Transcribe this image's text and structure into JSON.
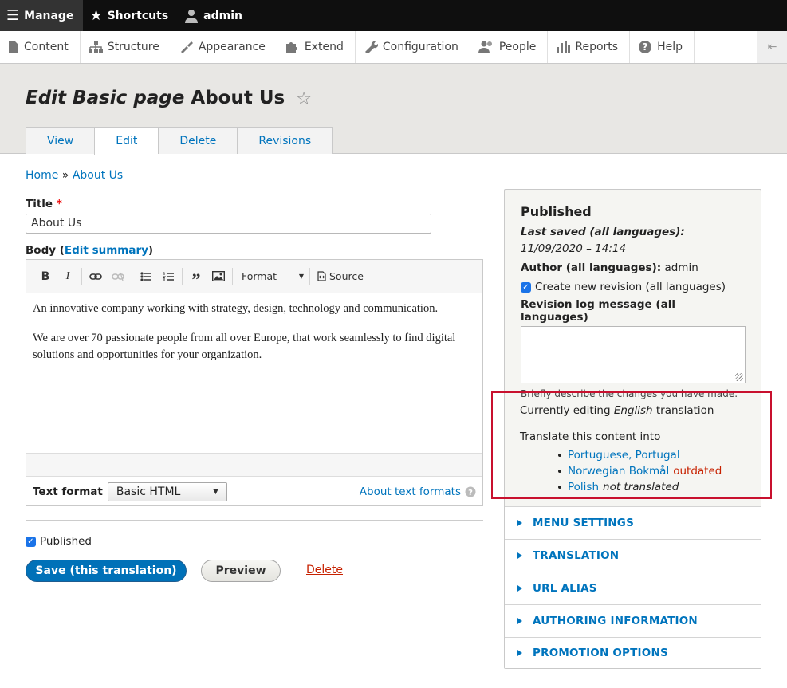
{
  "toolbar": {
    "manage": "Manage",
    "shortcuts": "Shortcuts",
    "user": "admin"
  },
  "admin_menu": [
    {
      "label": "Content",
      "icon": "file-icon"
    },
    {
      "label": "Structure",
      "icon": "sitemap-icon"
    },
    {
      "label": "Appearance",
      "icon": "paintbrush-icon"
    },
    {
      "label": "Extend",
      "icon": "puzzle-icon"
    },
    {
      "label": "Configuration",
      "icon": "wrench-icon"
    },
    {
      "label": "People",
      "icon": "people-icon"
    },
    {
      "label": "Reports",
      "icon": "bar-chart-icon"
    },
    {
      "label": "Help",
      "icon": "help-icon"
    }
  ],
  "page": {
    "title_prefix": "Edit Basic page",
    "title_name": "About Us"
  },
  "tabs": [
    "View",
    "Edit",
    "Delete",
    "Revisions"
  ],
  "breadcrumb": {
    "home": "Home",
    "sep": "»",
    "current": "About Us"
  },
  "form": {
    "title_label": "Title",
    "required_mark": "*",
    "title_value": "About Us",
    "body_label": "Body",
    "edit_summary": "Edit summary",
    "format_label": "Format",
    "source_label": "Source",
    "body_p1": "An innovative company working with strategy, design, technology and communication.",
    "body_p2": "We are over 70 passionate people from all over Europe, that work seamlessly to find digital solutions and opportunities for your organization.",
    "text_format_label": "Text format",
    "text_format_value": "Basic HTML",
    "about_formats": "About text formats",
    "published_label": "Published",
    "save_label": "Save (this translation)",
    "preview_label": "Preview",
    "delete_label": "Delete"
  },
  "sidebar": {
    "status": "Published",
    "last_saved_label": "Last saved (all languages):",
    "last_saved_value": "11/09/2020 – 14:14",
    "author_label": "Author (all languages):",
    "author_value": "admin",
    "new_revision": "Create new revision (all languages)",
    "revision_log_label": "Revision log message (all languages)",
    "revision_hint": "Briefly describe the changes you have made.",
    "editing_prefix": "Currently editing",
    "editing_lang": "English",
    "editing_suffix": "translation",
    "translate_into": "Translate this content into",
    "languages": [
      {
        "name": "Portuguese, Portugal",
        "status": ""
      },
      {
        "name": "Norwegian Bokmål",
        "status": "outdated"
      },
      {
        "name": "Polish",
        "status": "not translated"
      }
    ],
    "sections": [
      "MENU SETTINGS",
      "TRANSLATION",
      "URL ALIAS",
      "AUTHORING INFORMATION",
      "PROMOTION OPTIONS"
    ]
  },
  "colors": {
    "accent": "#0074bd",
    "primary_button": "#0071b8",
    "danger": "#c72100",
    "highlight_box": "#c8102e"
  }
}
